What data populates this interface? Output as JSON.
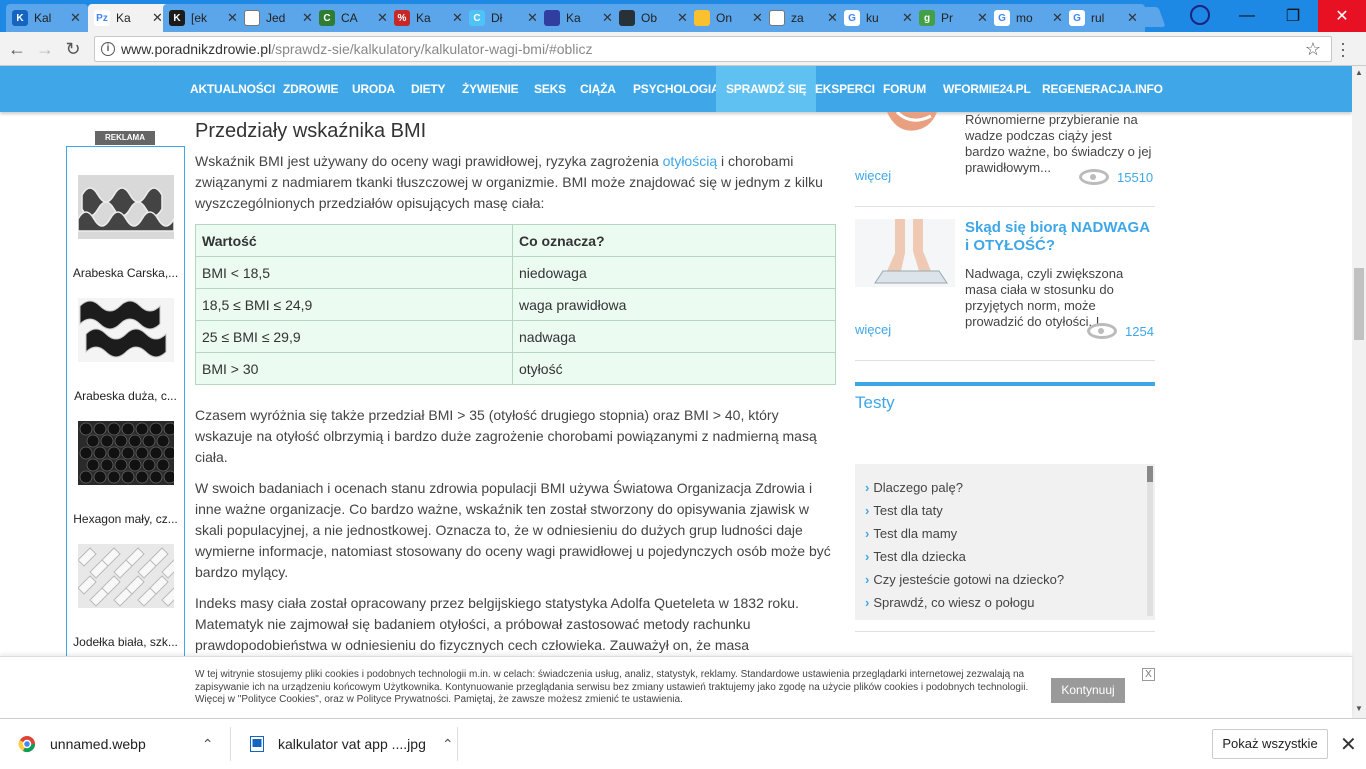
{
  "browser": {
    "tabs": [
      {
        "title": "Kal",
        "fav_color": "#1565c0",
        "fav_text": "K",
        "active": false
      },
      {
        "title": "Ka",
        "fav_color": "#ffffff",
        "fav_text": "Pz",
        "active": true
      },
      {
        "title": "[ek",
        "fav_color": "#1b1b1b",
        "fav_text": "K",
        "active": false
      },
      {
        "title": "Jed",
        "fav_color": "#ffffff",
        "fav_text": "",
        "active": false
      },
      {
        "title": "CA",
        "fav_color": "#2e7d32",
        "fav_text": "C",
        "active": false
      },
      {
        "title": "Ka",
        "fav_color": "#c62828",
        "fav_text": "%",
        "active": false
      },
      {
        "title": "Dł",
        "fav_color": "#4fc3f7",
        "fav_text": "C",
        "active": false
      },
      {
        "title": "Ka",
        "fav_color": "#303f9f",
        "fav_text": "",
        "active": false
      },
      {
        "title": "Ob",
        "fav_color": "#263238",
        "fav_text": "",
        "active": false
      },
      {
        "title": "On",
        "fav_color": "#fbc02d",
        "fav_text": "",
        "active": false
      },
      {
        "title": "za",
        "fav_color": "#ffffff",
        "fav_text": "",
        "active": false
      },
      {
        "title": "ku",
        "fav_color": "#ffffff",
        "fav_text": "G",
        "active": false
      },
      {
        "title": "Pr",
        "fav_color": "#43a047",
        "fav_text": "g",
        "active": false
      },
      {
        "title": "mo",
        "fav_color": "#ffffff",
        "fav_text": "G",
        "active": false
      },
      {
        "title": "rul",
        "fav_color": "#ffffff",
        "fav_text": "G",
        "active": false
      }
    ],
    "url_host": "www.poradnikzdrowie.pl",
    "url_path": "/sprawdz-sie/kalkulatory/kalkulator-wagi-bmi/#oblicz"
  },
  "nav": {
    "items": [
      "AKTUALNOŚCI",
      "ZDROWIE",
      "URODA",
      "DIETY",
      "ŻYWIENIE",
      "SEKS",
      "CIĄŻA",
      "PSYCHOLOGIA",
      "SPRAWDŹ SIĘ",
      "EKSPERCI",
      "FORUM",
      "WFORMIE24.PL",
      "REGENERACJA.INFO"
    ],
    "active_index": 8
  },
  "ads": {
    "label": "REKLAMA",
    "items": [
      {
        "caption": "Arabeska Carska,..."
      },
      {
        "caption": "Arabeska duża, c..."
      },
      {
        "caption": "Hexagon mały, cz..."
      },
      {
        "caption": "Jodełka biała, szk..."
      }
    ]
  },
  "article": {
    "heading": "Przedziały wskaźnika BMI",
    "intro_before": "Wskaźnik BMI jest używany do oceny wagi prawidłowej, ryzyka zagrożenia ",
    "intro_link": "otyłością",
    "intro_after": " i chorobami związanymi z nadmiarem tkanki tłuszczowej w organizmie. BMI może znajdować się w jednym z kilku wyszczególnionych przedziałów opisujących masę ciała:",
    "table": {
      "headers": [
        "Wartość",
        "Co oznacza?"
      ],
      "rows": [
        [
          "BMI < 18,5",
          "niedowaga"
        ],
        [
          "18,5 ≤ BMI ≤ 24,9",
          "waga prawidłowa"
        ],
        [
          "25 ≤ BMI ≤ 29,9",
          "nadwaga"
        ],
        [
          "BMI > 30",
          "otyłość"
        ]
      ]
    },
    "p2": "Czasem wyróżnia się także przedział BMI > 35 (otyłość drugiego stopnia) oraz BMI > 40, który wskazuje na otyłość olbrzymią i bardzo duże zagrożenie chorobami powiązanymi z nadmierną masą ciała.",
    "p3": "W swoich badaniach i ocenach stanu zdrowia populacji BMI używa Światowa Organizacja Zdrowia i inne ważne organizacje. Co bardzo ważne, wskaźnik ten został stworzony do opisywania zjawisk w skali populacyjnej, a nie jednostkowej. Oznacza to, że w odniesieniu do dużych grup ludności daje wymierne informacje, natomiast stosowany do oceny wagi prawidłowej u pojedynczych osób może być bardzo mylący.",
    "p4": "Indeks masy ciała został opracowany przez belgijskiego statystyka Adolfa Queteleta w 1832 roku. Matematyk nie zajmował się badaniem otyłości, a próbował zastosować metody rachunku prawdopodobieństwa w odniesieniu do fizycznych cech człowieka. Zauważył on, że masa"
  },
  "sidebar": {
    "card1": {
      "snippet": "Równomierne przybieranie na wadze podczas ciąży jest bardzo ważne, bo świadczy o jej prawidłowym...",
      "more": "więcej",
      "views": "15510"
    },
    "card2": {
      "title": "Skąd się biorą NADWAGA i OTYŁOŚĆ?",
      "snippet": "Nadwaga, czyli zwiększona masa ciała w stosunku do przyjętych norm, może prowadzić do otyłości. I...",
      "more": "więcej",
      "views": "1254"
    },
    "tests_title": "Testy",
    "tests": [
      "Dlaczego palę?",
      "Test dla taty",
      "Test dla mamy",
      "Test dla dziecka",
      "Czy jesteście gotowi na dziecko?",
      "Sprawdź, co wiesz o połogu"
    ]
  },
  "cookie": {
    "text": "W tej witrynie stosujemy pliki cookies i podobnych technologii m.in. w celach: świadczenia usług, analiz, statystyk, reklamy. Standardowe ustawienia przeglądarki internetowej zezwalają na zapisywanie ich na urządzeniu końcowym Użytkownika. Kontynuowanie przeglądania serwisu bez zmiany ustawień traktujemy jako zgodę na użycie plików cookies i podobnych technologii. Więcej w \"Polityce Cookies\", oraz w Polityce Prywatności. Pamiętaj, że zawsze możesz zmienić te ustawienia.",
    "button": "Kontynuuj",
    "close": "X"
  },
  "downloads": {
    "items": [
      "unnamed.webp",
      "kalkulator vat app ....jpg"
    ],
    "show_all": "Pokaż wszystkie"
  }
}
